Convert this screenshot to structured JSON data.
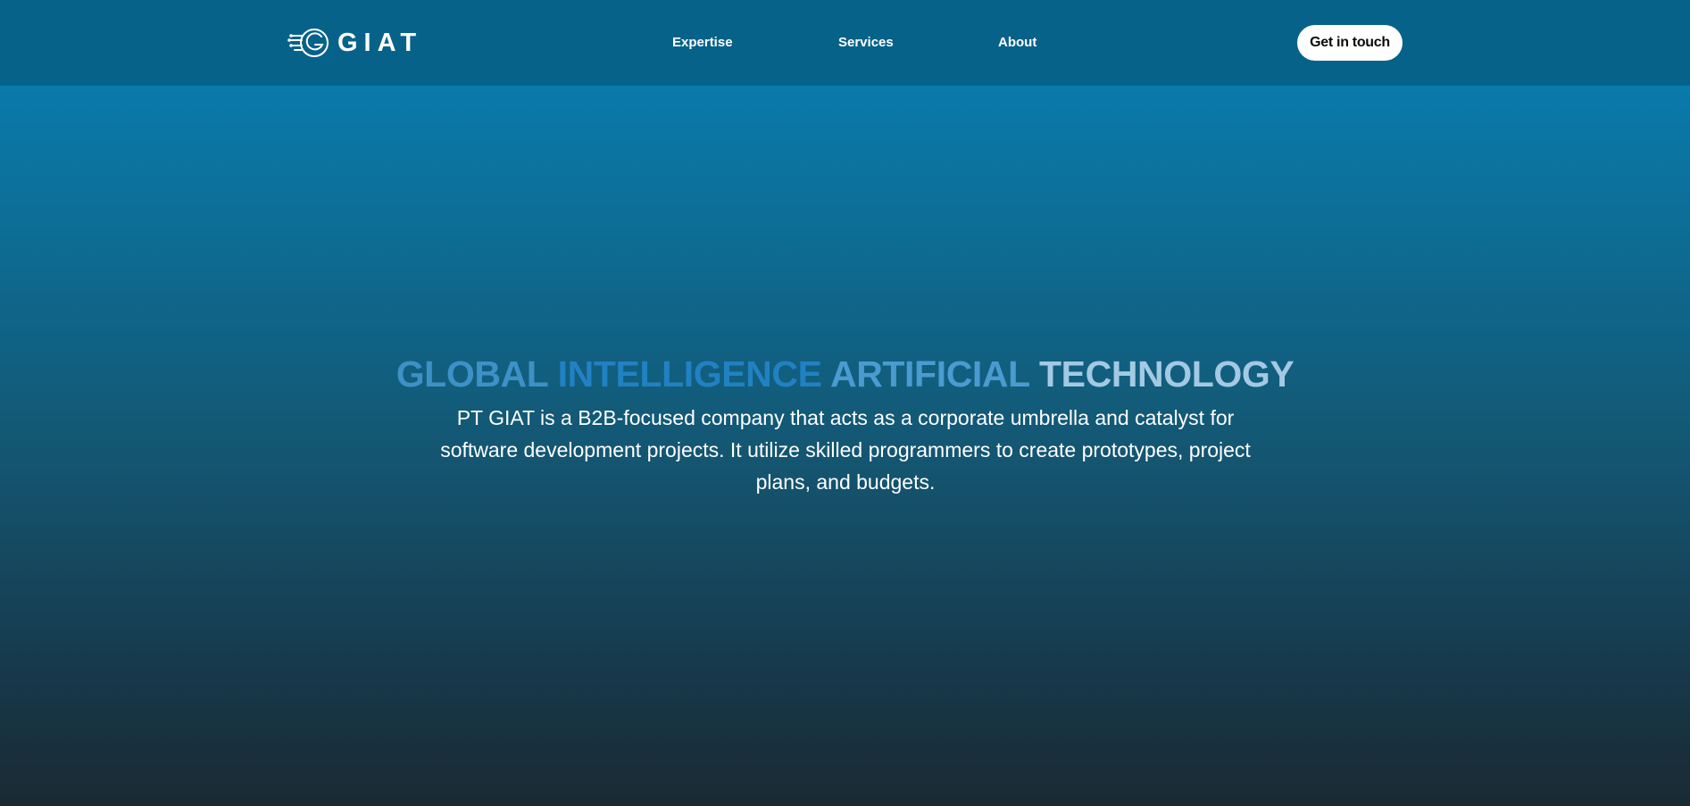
{
  "brand": {
    "name": "GIAT",
    "logo_icon": "giat-circuit-g-icon"
  },
  "nav": {
    "items": [
      {
        "label": "Expertise"
      },
      {
        "label": "Services"
      },
      {
        "label": "About"
      }
    ],
    "cta_label": "Get in touch"
  },
  "hero": {
    "title_words": [
      "GLOBAL",
      "INTELLIGENCE",
      "ARTIFICIAL",
      "TECHNOLOGY"
    ],
    "description": "PT GIAT is a B2B-focused company that acts as a corporate umbrella and catalyst for software development projects. It utilize skilled programmers to create prototypes, project plans, and budgets."
  },
  "colors": {
    "header_bg": "#07628a",
    "page_gradient_top": "#0a7aab",
    "page_gradient_bottom": "#1a2a33",
    "title_word_colors": [
      "#3d91c6",
      "#2181c3",
      "#4a9bd0",
      "#a3c9e3"
    ],
    "cta_bg": "#ffffff",
    "cta_text": "#0b0b0b"
  }
}
